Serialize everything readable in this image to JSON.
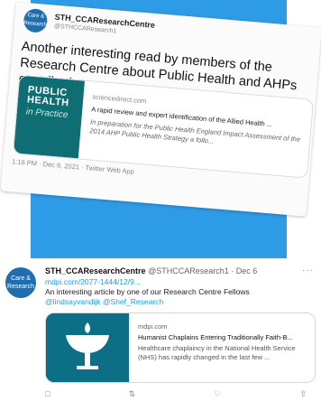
{
  "photo": {
    "avatar_text": "Care & Research",
    "user_name": "STH_CCAResearchCentre",
    "user_handle": "@STHCCAResearch1",
    "body_text": "Another interesting read by members of the Research Centre about Public Health and AHPs contributions",
    "link_card": {
      "thumb_title": "PUBLIC HEALTH",
      "thumb_subtitle": "in Practice",
      "domain": "sciencedirect.com",
      "title": "A rapid review and expert identification of the Allied Health ...",
      "description": "In preparation for the Public Health England Impact Assessment of the 2014 AHP Public Health Strategy a follo..."
    },
    "timestamp": "1:16 PM · Dec 6, 2021 · Twitter Web App"
  },
  "tweet": {
    "avatar_text": "Care & Research",
    "user_name": "STH_CCAResearchCentre",
    "user_handle": "@STHCCAResearch1",
    "date": "· Dec 6",
    "more": "···",
    "url": "mdpi.com/2077-1444/12/9...",
    "text": "An interesting article by one of our Research Centre Fellows",
    "mentions": "@lindsayvandijk @Shef_Research",
    "card": {
      "domain": "mdpi.com",
      "title": "Humanist Chaplains Entering Traditionally Faith-B...",
      "description": "Healthcare chaplaincy in the National Health Service (NHS) has rapidly changed in the last few ..."
    },
    "actions": {
      "reply": "reply-icon",
      "retweet": "retweet-icon",
      "like": "like-icon",
      "share": "share-icon"
    }
  }
}
